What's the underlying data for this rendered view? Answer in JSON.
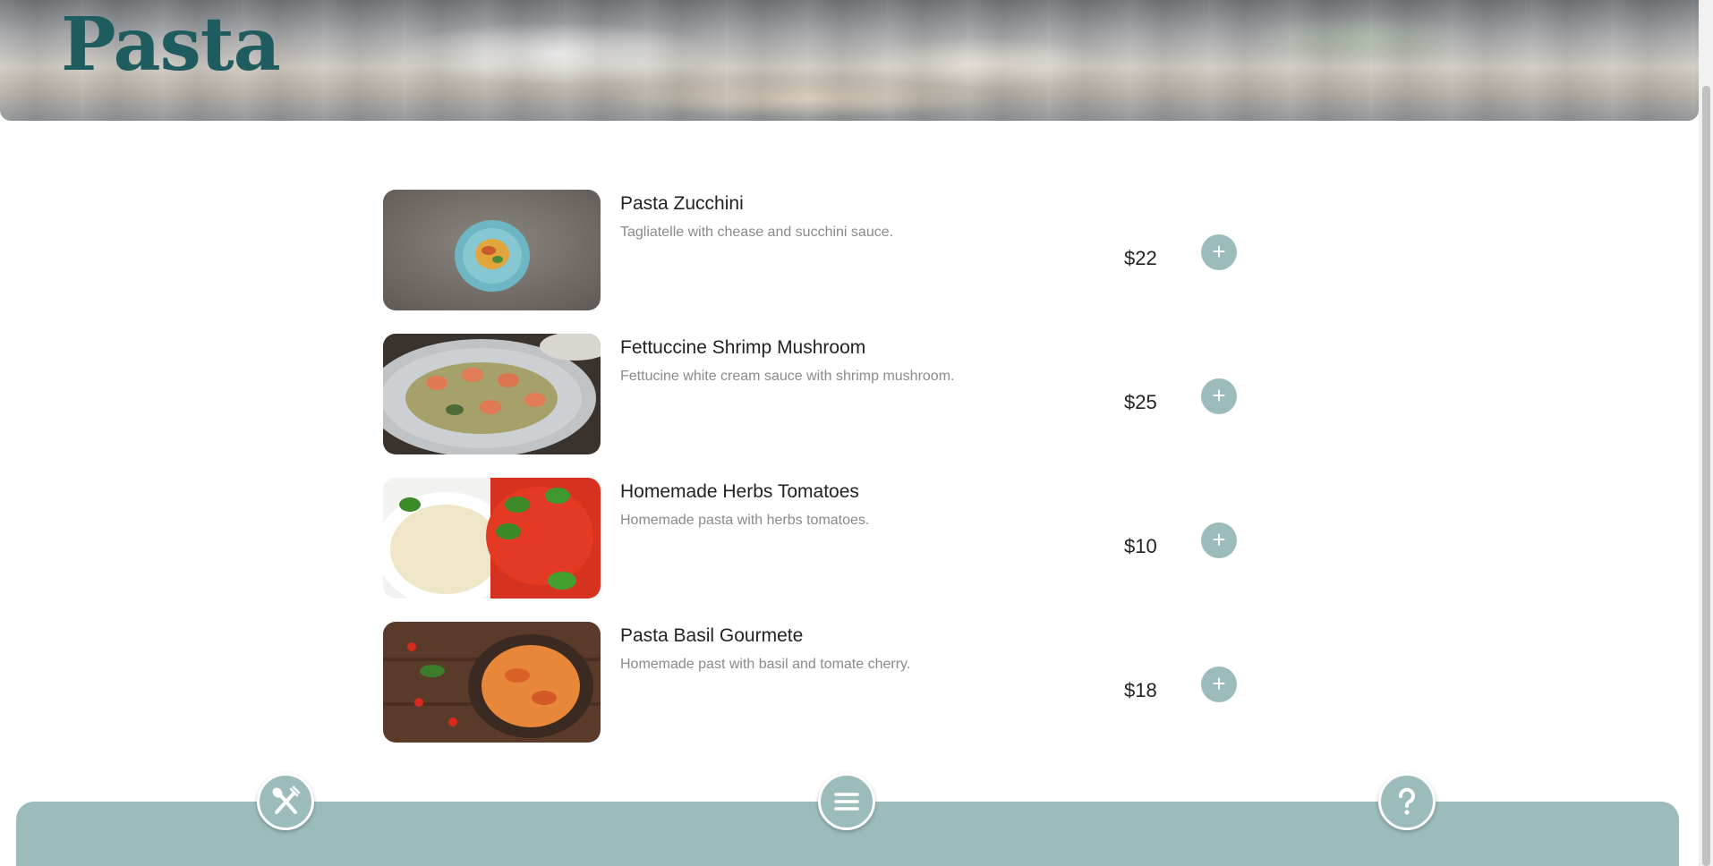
{
  "header": {
    "title": "Pasta"
  },
  "menu": {
    "items": [
      {
        "name": "Pasta Zucchini",
        "description": "Tagliatelle with chease and succhini sauce.",
        "price": "$22",
        "add_label": "+",
        "image_icon": "pasta-zucchini-photo"
      },
      {
        "name": "Fettuccine Shrimp Mushroom",
        "description": "Fettucine white cream sauce with shrimp mushroom.",
        "price": "$25",
        "add_label": "+",
        "image_icon": "fettuccine-shrimp-photo"
      },
      {
        "name": "Homemade Herbs Tomatoes",
        "description": "Homemade pasta with herbs tomatoes.",
        "price": "$10",
        "add_label": "+",
        "image_icon": "herbs-tomatoes-photo"
      },
      {
        "name": "Pasta Basil Gourmete",
        "description": "Homemade past with basil and tomate cherry.",
        "price": "$18",
        "add_label": "+",
        "image_icon": "basil-gourmete-photo"
      }
    ]
  },
  "bottom_nav": {
    "items": [
      {
        "icon": "restaurant-icon"
      },
      {
        "icon": "menu-icon"
      },
      {
        "icon": "help-icon"
      }
    ]
  },
  "colors": {
    "accent": "#9bbcbb",
    "title": "#1e5c60"
  }
}
